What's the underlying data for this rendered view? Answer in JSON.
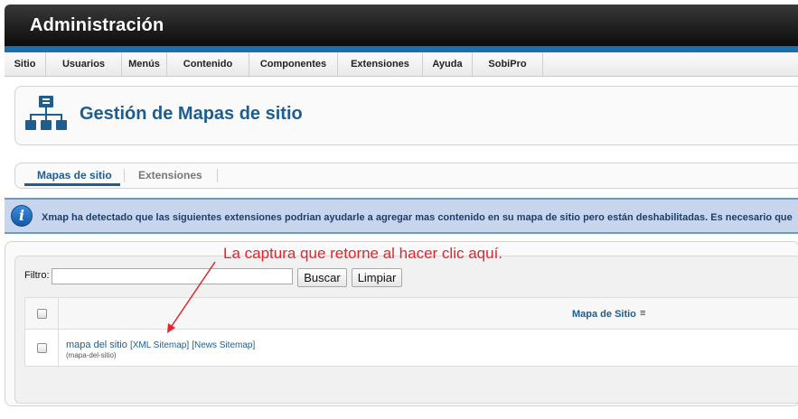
{
  "header": {
    "title": "Administración"
  },
  "menu": [
    "Sitio",
    "Usuarios",
    "Menús",
    "Contenido",
    "Componentes",
    "Extensiones",
    "Ayuda",
    "SobiPro"
  ],
  "page": {
    "title": "Gestión de Mapas de sitio",
    "icon": "sitemap-icon"
  },
  "tabs": [
    {
      "label": "Mapas de sitio",
      "active": true
    },
    {
      "label": "Extensiones",
      "active": false
    }
  ],
  "notice": {
    "icon": "info-icon",
    "text": "Xmap ha detectado que las siguientes extensiones podrian ayudarle a agregar mas contenido en su mapa de sitio pero están deshabilitadas. Es necesario que"
  },
  "annotation": {
    "text": "La captura que retorne al hacer clic aquí."
  },
  "filter": {
    "label": "Filtro:",
    "value": "",
    "search_button": "Buscar",
    "clear_button": "Limpiar"
  },
  "table": {
    "header": "Mapa de Sitio",
    "rows": [
      {
        "name": "mapa del sitio",
        "xml_link": "[XML Sitemap]",
        "news_link": "[News Sitemap]",
        "alias": "(mapa-del-sitio)"
      }
    ]
  },
  "colors": {
    "brand_blue": "#1d5d90",
    "header_strip": "#1a6fb0",
    "notice_bg": "#c7d6ec",
    "annotation_red": "#e3242b"
  }
}
